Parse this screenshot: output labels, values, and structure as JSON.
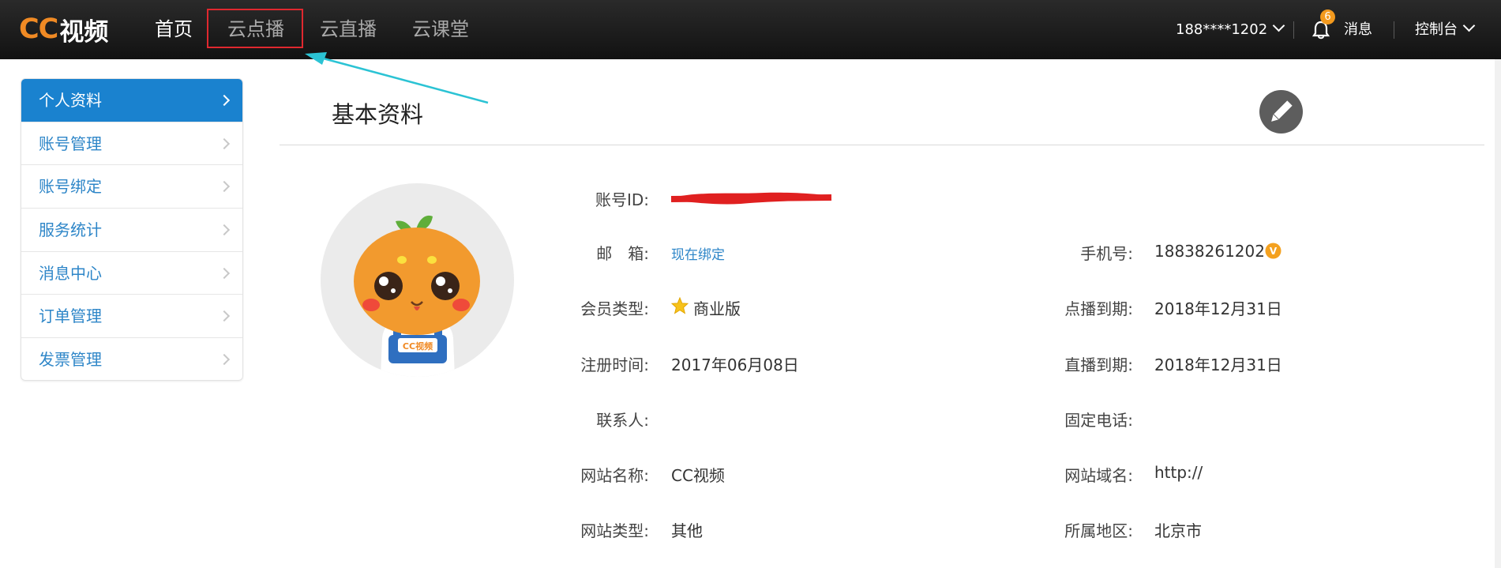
{
  "header": {
    "logo_cc": "CC",
    "logo_text": "视频",
    "nav": [
      "首页",
      "云点播",
      "云直播",
      "云课堂"
    ],
    "user": "188****1202",
    "notif_count": "6",
    "messages_label": "消息",
    "console_label": "控制台"
  },
  "sidebar": {
    "items": [
      {
        "label": "个人资料"
      },
      {
        "label": "账号管理"
      },
      {
        "label": "账号绑定"
      },
      {
        "label": "服务统计"
      },
      {
        "label": "消息中心"
      },
      {
        "label": "订单管理"
      },
      {
        "label": "发票管理"
      }
    ]
  },
  "main": {
    "title": "基本资料",
    "avatar_badge": "CC视频",
    "fields": {
      "account_id": {
        "label": "账号ID:",
        "value": ""
      },
      "email": {
        "label": "邮　箱:",
        "value": "现在绑定"
      },
      "phone": {
        "label": "手机号:",
        "value": "18838261202"
      },
      "member_type": {
        "label": "会员类型:",
        "value": "商业版"
      },
      "vod_expire": {
        "label": "点播到期:",
        "value": "2018年12月31日"
      },
      "reg_time": {
        "label": "注册时间:",
        "value": "2017年06月08日"
      },
      "live_expire": {
        "label": "直播到期:",
        "value": "2018年12月31日"
      },
      "contact": {
        "label": "联系人:",
        "value": ""
      },
      "landline": {
        "label": "固定电话:",
        "value": ""
      },
      "site_name": {
        "label": "网站名称:",
        "value": "CC视频"
      },
      "site_domain": {
        "label": "网站域名:",
        "value": "http://"
      },
      "site_type": {
        "label": "网站类型:",
        "value": "其他"
      },
      "region": {
        "label": "所属地区:",
        "value": "北京市"
      }
    },
    "phone_verified_badge": "V"
  },
  "colors": {
    "accent": "#1a82cf",
    "link": "#2e86c8",
    "brand_orange": "#f08a24",
    "highlight_box": "#e0282f",
    "arrow": "#2bc3d4"
  }
}
